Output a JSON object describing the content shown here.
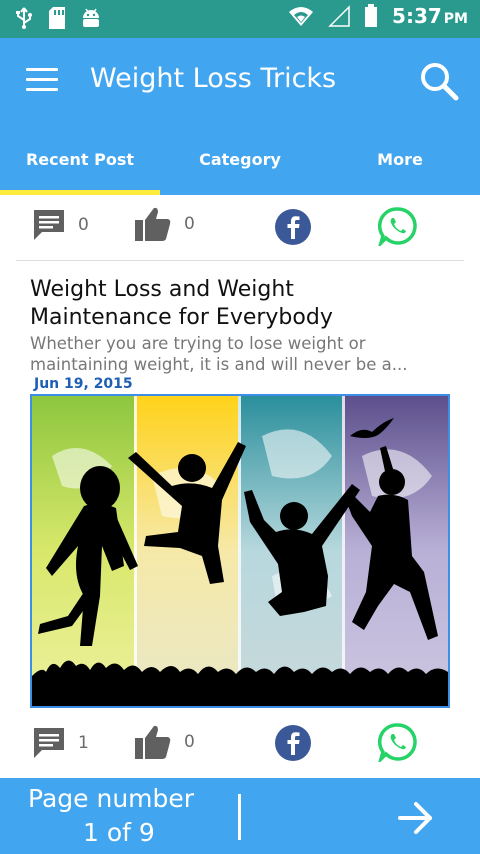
{
  "status_bar": {
    "time": "5:37",
    "ampm": "PM",
    "icons": [
      "usb-icon",
      "sd-card-icon",
      "android-icon",
      "wifi-icon",
      "signal-icon",
      "battery-icon"
    ]
  },
  "app_bar": {
    "title": "Weight Loss Tricks",
    "menu_icon": "hamburger-menu-icon",
    "search_icon": "search-icon",
    "background": "#42a5ef"
  },
  "tabs": [
    {
      "label": "Recent Post",
      "active": true
    },
    {
      "label": "Category",
      "active": false
    },
    {
      "label": "More",
      "active": false
    }
  ],
  "top_actions": {
    "comments": "0",
    "likes": "0"
  },
  "post": {
    "title_line1": "Weight Loss and Weight",
    "title_line2": "Maintenance for Everybody",
    "excerpt_line1": "Whether you are trying to lose weight or",
    "excerpt_line2": "maintaining weight, it is and will never be a...",
    "date": "Jun 19, 2015",
    "comments": "1",
    "likes": "0"
  },
  "pagination": {
    "label": "Page number",
    "count": "1 of 9",
    "next_icon": "arrow-right-icon"
  },
  "colors": {
    "status_bar": "#2a9a8e",
    "accent": "#42a5ef",
    "tab_indicator": "#ffeb3b",
    "facebook": "#3b5998",
    "whatsapp": "#25d366",
    "date_text": "#1e5fb3"
  }
}
